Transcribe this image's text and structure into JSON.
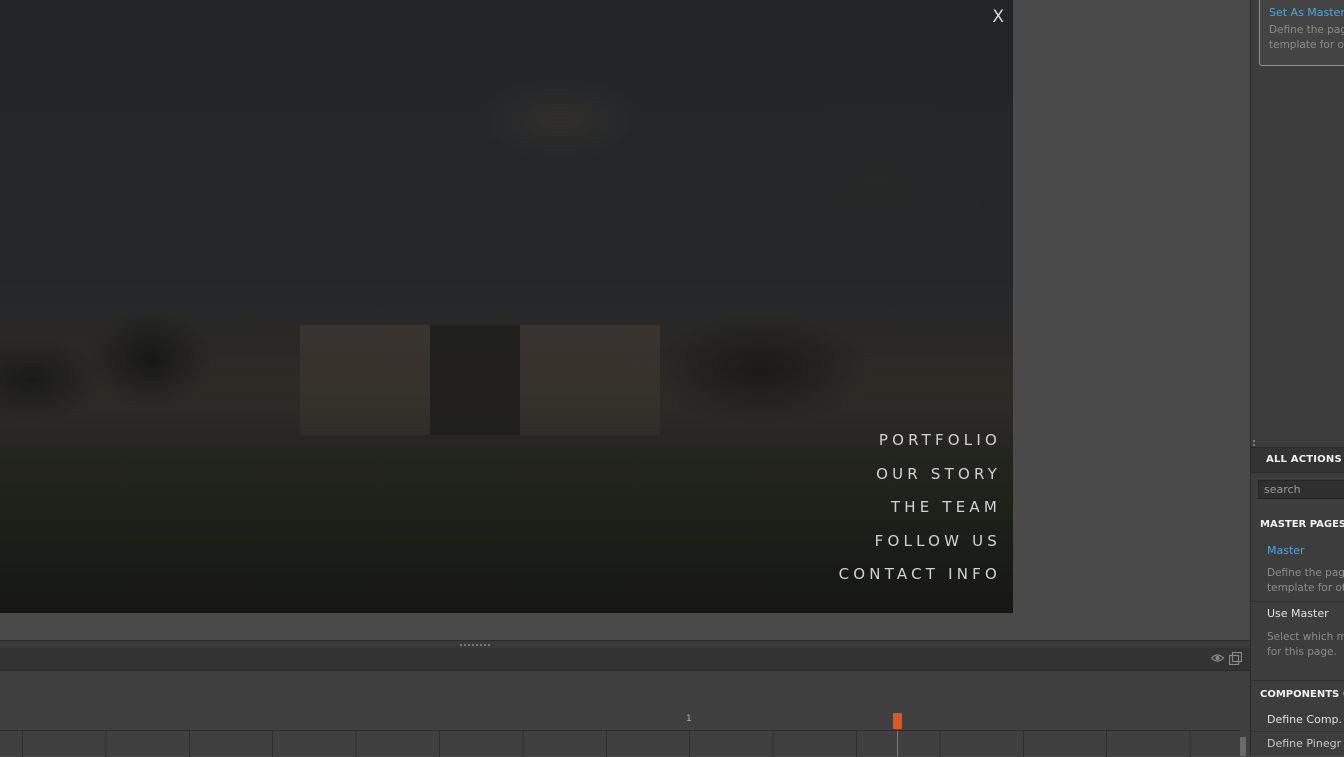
{
  "stage": {
    "close_label": "X",
    "menu": [
      "PORTFOLIO",
      "OUR STORY",
      "THE TEAM",
      "FOLLOW US",
      "CONTACT INFO"
    ]
  },
  "timeline": {
    "ruler_number": "1",
    "icons": [
      "eye-icon",
      "window-icon"
    ],
    "accent_color": "#e0561c"
  },
  "right_panel": {
    "selected_action": {
      "title": "Set As Master P",
      "desc_line1": "Define the pag",
      "desc_line2": "template for ot"
    },
    "all_actions_label": "ALL ACTIONS",
    "search_placeholder": "search",
    "master_pages": {
      "header": "MASTER PAGES",
      "header_extra": "C",
      "items": [
        {
          "label": "Master",
          "desc_line1": "Define the page",
          "desc_line2": "template for ot"
        },
        {
          "label": "Use Master",
          "desc_line1": "Select which m",
          "desc_line2": "for this page."
        }
      ]
    },
    "components": {
      "header": "COMPONENTS",
      "header_extra": "Co",
      "items": [
        "Define Comp.",
        "Define Pinegr"
      ]
    },
    "link_color": "#48a8e0",
    "highlight_color": "#c8823e"
  }
}
